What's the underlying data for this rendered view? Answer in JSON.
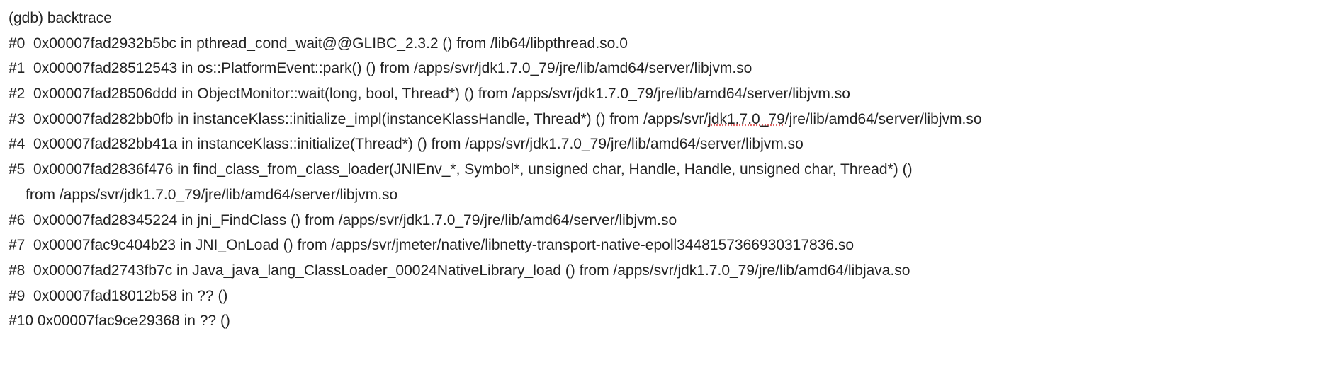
{
  "prompt": "(gdb) backtrace",
  "frames": [
    {
      "idx": "#0",
      "addr": "0x00007fad2932b5bc",
      "mid": " in pthread_cond_wait@@GLIBC_2.3.2 () from /lib64/libpthread.so.0"
    },
    {
      "idx": "#1",
      "addr": "0x00007fad28512543",
      "mid": " in os::PlatformEvent::park() () from /apps/svr/jdk1.7.0_79/jre/lib/amd64/server/libjvm.so"
    },
    {
      "idx": "#2",
      "addr": "0x00007fad28506ddd",
      "mid": " in ObjectMonitor::wait(long, bool, Thread*) () from /apps/svr/jdk1.7.0_79/jre/lib/amd64/server/libjvm.so"
    },
    {
      "idx": "#3",
      "addr": "0x00007fad282bb0fb",
      "mid_a": " in instanceKlass::initialize_impl(instanceKlassHandle, Thread*) () from /apps/svr/",
      "mid_sq": "jdk1.7.0_79",
      "mid_b": "/jre/lib/amd64/server/libjvm.so"
    },
    {
      "idx": "#4",
      "addr": "0x00007fad282bb41a",
      "mid": " in instanceKlass::initialize(Thread*) () from /apps/svr/jdk1.7.0_79/jre/lib/amd64/server/libjvm.so"
    },
    {
      "idx": "#5",
      "addr": "0x00007fad2836f476",
      "mid": " in find_class_from_class_loader(JNIEnv_*, Symbol*, unsigned char, Handle, Handle, unsigned char, Thread*) ()",
      "cont": "from /apps/svr/jdk1.7.0_79/jre/lib/amd64/server/libjvm.so"
    },
    {
      "idx": "#6",
      "addr": "0x00007fad28345224",
      "mid": " in jni_FindClass () from /apps/svr/jdk1.7.0_79/jre/lib/amd64/server/libjvm.so"
    },
    {
      "idx": "#7",
      "addr": "0x00007fac9c404b23",
      "mid": " in JNI_OnLoad () from /apps/svr/jmeter/native/libnetty-transport-native-epoll3448157366930317836.so"
    },
    {
      "idx": "#8",
      "addr": "0x00007fad2743fb7c",
      "mid": " in Java_java_lang_ClassLoader_00024NativeLibrary_load () from /apps/svr/jdk1.7.0_79/jre/lib/amd64/libjava.so"
    },
    {
      "idx": "#9",
      "addr": "0x00007fad18012b58",
      "mid": " in ?? ()"
    },
    {
      "idx": "#10",
      "addr": "0x00007fac9ce29368",
      "mid": " in ?? ()"
    }
  ]
}
